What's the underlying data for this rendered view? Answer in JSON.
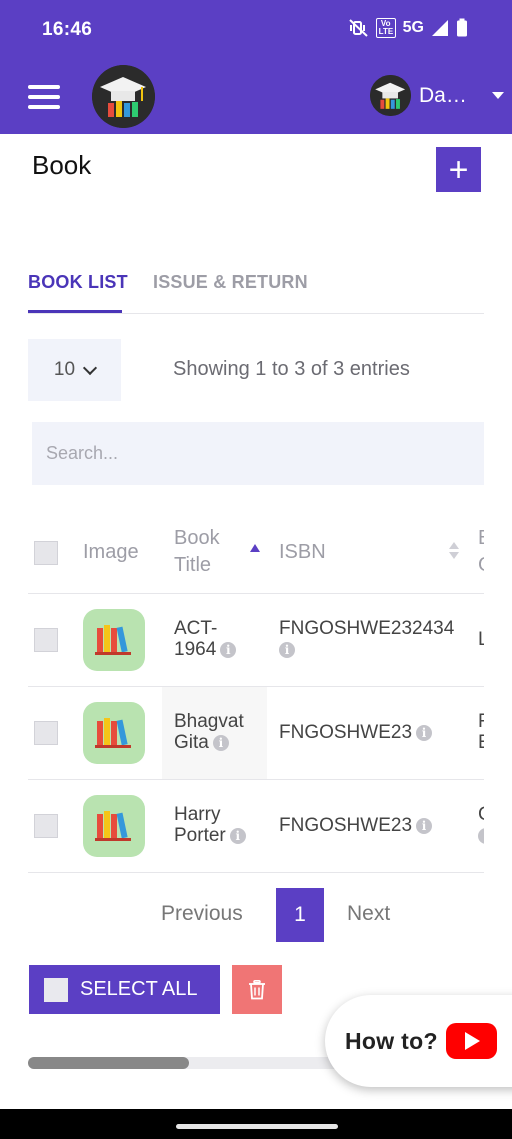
{
  "status_bar": {
    "time": "16:46",
    "network": "5G",
    "volte": "Vo LTE",
    "icons": [
      "mute-vibrate-icon",
      "volte-icon",
      "signal-icon",
      "battery-icon"
    ]
  },
  "app_bar": {
    "menu_icon": "hamburger-menu-icon",
    "user_name": "Das…"
  },
  "page": {
    "title": "Book",
    "add_label": "+"
  },
  "tabs": [
    {
      "label": "BOOK LIST",
      "active": true
    },
    {
      "label": "ISSUE & RETURN",
      "active": false
    }
  ],
  "controls": {
    "page_size": "10",
    "entries": "Showing 1 to 3 of 3 entries",
    "search_placeholder": "Search..."
  },
  "table": {
    "headers": {
      "image": "Image",
      "title_line1": "Book",
      "title_line2": "Title",
      "isbn": "ISBN",
      "next_line1": "B",
      "next_line2": "G"
    },
    "rows": [
      {
        "title_line1": "ACT-",
        "title_line2": "1964",
        "isbn": "FNGOSHWE232434",
        "next_line1": "L",
        "next_line2": ""
      },
      {
        "title_line1": "Bhagvat",
        "title_line2": "Gita",
        "isbn": "FNGOSHWE23",
        "next_line1": "F",
        "next_line2": "E"
      },
      {
        "title_line1": "Harry",
        "title_line2": "Porter",
        "isbn": "FNGOSHWE23",
        "next_line1": "C",
        "next_line2": ""
      }
    ]
  },
  "pagination": {
    "previous": "Previous",
    "current": "1",
    "next": "Next"
  },
  "actions": {
    "select_all": "SELECT ALL",
    "delete_icon": "trash-icon"
  },
  "howto": {
    "label": "How to?",
    "icon": "youtube-play-icon"
  },
  "colors": {
    "primary": "#5b3fc4",
    "tab_active": "#4a35b8",
    "delete": "#f07575",
    "book_bg": "#b9e3b0",
    "input_bg": "#f1f3fa"
  }
}
